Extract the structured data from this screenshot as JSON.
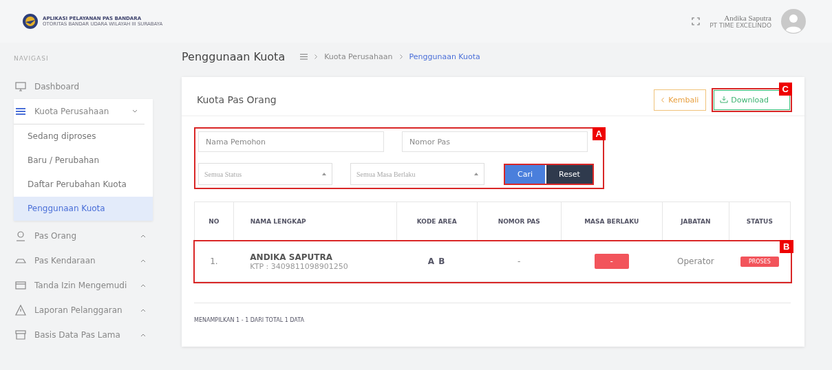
{
  "header": {
    "app_title": "APLIKASI PELAYANAN PAS BANDARA",
    "app_subtitle": "OTORITAS BANDAR UDARA WILAYAH III SURABAYA",
    "user_name": "Andika Saputra",
    "user_company": "PT TIME EXCELINDO"
  },
  "sidebar": {
    "section_label": "NAVIGASI",
    "items": [
      {
        "label": "Dashboard",
        "kind": "link"
      },
      {
        "label": "Kuota Perusahaan",
        "kind": "group",
        "expanded": true,
        "children": [
          {
            "label": "Sedang diproses",
            "selected": false
          },
          {
            "label": "Baru / Perubahan",
            "selected": false
          },
          {
            "label": "Daftar Perubahan Kuota",
            "selected": false
          },
          {
            "label": "Penggunaan Kuota",
            "selected": true
          }
        ]
      },
      {
        "label": "Pas Orang",
        "kind": "group",
        "expanded": false
      },
      {
        "label": "Pas Kendaraan",
        "kind": "group",
        "expanded": false
      },
      {
        "label": "Tanda Izin Mengemudi",
        "kind": "group",
        "expanded": false
      },
      {
        "label": "Laporan Pelanggaran",
        "kind": "group",
        "expanded": false
      },
      {
        "label": "Basis Data Pas Lama",
        "kind": "group",
        "expanded": false
      }
    ]
  },
  "page": {
    "title": "Penggunaan Kuota",
    "breadcrumbs": [
      {
        "label": "Kuota Perusahaan",
        "selected": false
      },
      {
        "label": "Penggunaan Kuota",
        "selected": true
      }
    ]
  },
  "card": {
    "title": "Kuota Pas Orang",
    "back_button": "Kembali",
    "download_button": "Download",
    "filters": {
      "name_placeholder": "Nama Pemohon",
      "pass_placeholder": "Nomor Pas",
      "status_select": "Semua Status",
      "validity_select": "Semua Masa Berlaku",
      "search_button": "Cari",
      "reset_button": "Reset"
    },
    "table": {
      "columns": [
        "NO",
        "NAMA LENGKAP",
        "KODE AREA",
        "NOMOR PAS",
        "MASA BERLAKU",
        "JABATAN",
        "STATUS"
      ],
      "rows": [
        {
          "no": "1.",
          "name": "ANDIKA SAPUTRA",
          "ktp": "KTP : 3409811098901250",
          "area": "A B",
          "pass_number": "-",
          "validity": "-",
          "position": "Operator",
          "status": "PROSES"
        }
      ]
    },
    "footer": "MENAMPILKAN 1 - 1 DARI TOTAL 1 DATA"
  },
  "callouts": [
    {
      "letter": "A"
    },
    {
      "letter": "B"
    },
    {
      "letter": "C"
    }
  ]
}
